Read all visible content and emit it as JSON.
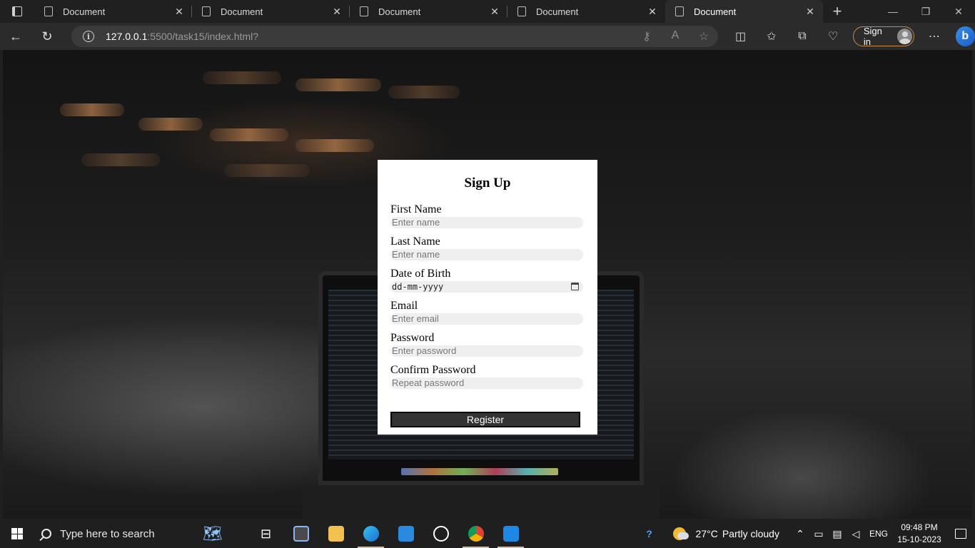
{
  "browser": {
    "tabs": [
      {
        "title": "Document",
        "active": false
      },
      {
        "title": "Document",
        "active": false
      },
      {
        "title": "Document",
        "active": false
      },
      {
        "title": "Document",
        "active": false
      },
      {
        "title": "Document",
        "active": true
      }
    ],
    "url_host": "127.0.0.1",
    "url_rest": ":5500/task15/index.html?",
    "sign_in_label": "Sign in"
  },
  "form": {
    "title": "Sign Up",
    "fields": [
      {
        "label": "First Name",
        "placeholder": "Enter name"
      },
      {
        "label": "Last Name",
        "placeholder": "Enter name"
      },
      {
        "label": "Date of Birth",
        "placeholder": "dd-mm-yyyy"
      },
      {
        "label": "Email",
        "placeholder": "Enter email"
      },
      {
        "label": "Password",
        "placeholder": "Enter password"
      },
      {
        "label": "Confirm Password",
        "placeholder": "Repeat password"
      }
    ],
    "submit_label": "Register"
  },
  "taskbar": {
    "search_placeholder": "Type here to search",
    "weather_temp": "27°C",
    "weather_text": "Partly cloudy",
    "language": "ENG",
    "time": "09:48 PM",
    "date": "15-10-2023"
  },
  "colors": {
    "accent": "#c98a4a",
    "register_button": "#333333"
  }
}
